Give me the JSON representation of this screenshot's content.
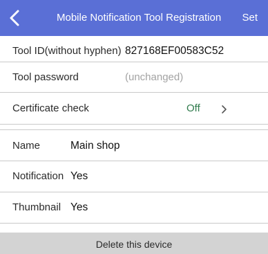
{
  "header": {
    "title": "Mobile Notification Tool Registration",
    "set_label": "Set"
  },
  "settings": {
    "tool_id": {
      "label": "Tool ID(without hyphen)",
      "value": "827168EF00583C52"
    },
    "tool_password": {
      "label": "Tool password",
      "placeholder": "(unchanged)"
    },
    "certificate_check": {
      "label": "Certificate check",
      "value": "Off"
    }
  },
  "device": {
    "name": {
      "label": "Name",
      "value": "Main shop"
    },
    "notification": {
      "label": "Notification",
      "value": "Yes"
    },
    "thumbnail": {
      "label": "Thumbnail",
      "value": "Yes"
    }
  },
  "footer": {
    "delete_label": "Delete this device"
  },
  "colors": {
    "header_bg": "#5a6fd6",
    "off_status": "#2e7a4b",
    "footer_bg": "#d3d3d3"
  }
}
